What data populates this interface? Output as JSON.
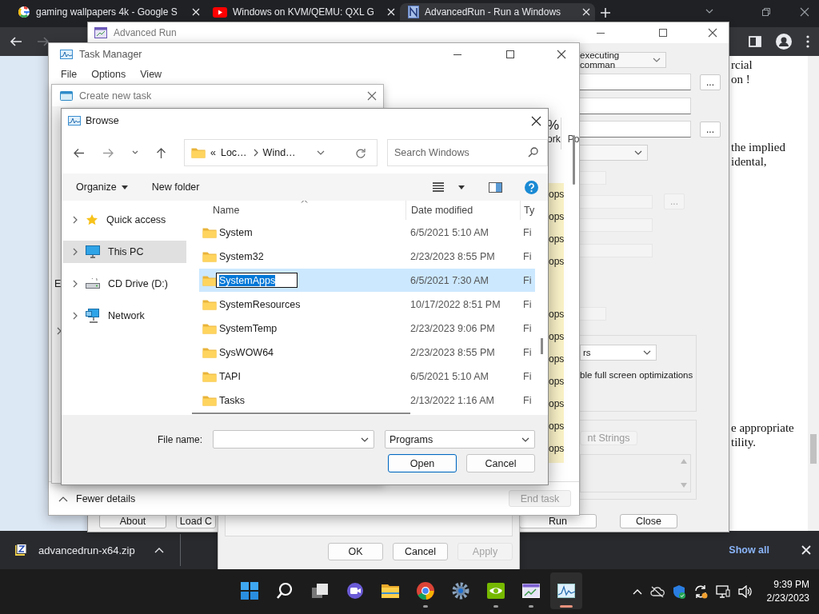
{
  "browser": {
    "tabs": [
      {
        "title": "gaming wallpapers 4k - Google S",
        "kind": "google",
        "selected": false
      },
      {
        "title": "Windows on KVM/QEMU: QXL G",
        "kind": "youtube",
        "selected": false
      },
      {
        "title": "AdvancedRun - Run a Windows",
        "kind": "site",
        "selected": true
      }
    ],
    "page_paragraphs": [
      {
        "lines": [
          "rcial",
          "on !"
        ]
      },
      {
        "lines": [
          "the implied",
          "idental,"
        ]
      },
      {
        "lines": [
          "e appropriate",
          "tility."
        ]
      }
    ]
  },
  "downloads": {
    "file": "advancedrun-x64.zip",
    "show_all": "Show all"
  },
  "advanced_run": {
    "title": "Advanced Run",
    "run_mode": "executing comman",
    "ellipsis_buttons": [
      {
        "label": "...",
        "disabled": false
      },
      {
        "label": "...",
        "disabled": false
      },
      {
        "label": "...",
        "disabled": true
      }
    ],
    "window_state": "rs",
    "fullscreen_option": "ble full screen optimizations",
    "strings_button": "nt Strings",
    "buttons": [
      "About",
      "Load C",
      "Run",
      "Close"
    ]
  },
  "properties_dialog": {
    "buttons": [
      {
        "label": "OK",
        "disabled": false
      },
      {
        "label": "Cancel",
        "disabled": false
      },
      {
        "label": "Apply",
        "disabled": true
      }
    ]
  },
  "task_manager": {
    "title": "Task Manager",
    "menu": [
      "File",
      "Options",
      "View"
    ],
    "column_percent": "%",
    "column_labels": [
      "ork",
      "Po"
    ],
    "cells_upper": [
      "ops",
      "ops",
      "ops",
      "ops"
    ],
    "cells_lower": [
      "ops",
      "ops",
      "ops",
      "ops",
      "ops",
      "ops",
      "ops"
    ],
    "fewer_details": "Fewer details",
    "end_task": {
      "label": "End task",
      "disabled": true
    }
  },
  "create_new_task": {
    "title": "Create new task",
    "fragment": "E"
  },
  "browse": {
    "title": "Browse",
    "path_overflow": "«",
    "path": [
      "Loc…",
      "Wind…"
    ],
    "search_placeholder": "Search Windows",
    "toolbar": {
      "organize": "Organize",
      "new_folder": "New folder"
    },
    "tree": [
      {
        "label": "Quick access",
        "kind": "star",
        "selected": false
      },
      {
        "label": "This PC",
        "kind": "pc",
        "selected": true
      },
      {
        "label": "CD Drive (D:)",
        "kind": "drive",
        "selected": false
      },
      {
        "label": "Network",
        "kind": "network",
        "selected": false
      }
    ],
    "columns": [
      "Name",
      "Date modified",
      "Ty"
    ],
    "rows": [
      {
        "name": "System",
        "date": "6/5/2021 5:10 AM",
        "type": "Fi",
        "selected": false,
        "renaming": false
      },
      {
        "name": "System32",
        "date": "2/23/2023 8:55 PM",
        "type": "Fi",
        "selected": false,
        "renaming": false
      },
      {
        "name": "SystemApps",
        "date": "6/5/2021 7:30 AM",
        "type": "Fi",
        "selected": true,
        "renaming": true
      },
      {
        "name": "SystemResources",
        "date": "10/17/2022 8:51 PM",
        "type": "Fi",
        "selected": false,
        "renaming": false
      },
      {
        "name": "SystemTemp",
        "date": "2/23/2023 9:06 PM",
        "type": "Fi",
        "selected": false,
        "renaming": false
      },
      {
        "name": "SysWOW64",
        "date": "2/23/2023 8:55 PM",
        "type": "Fi",
        "selected": false,
        "renaming": false
      },
      {
        "name": "TAPI",
        "date": "6/5/2021 5:10 AM",
        "type": "Fi",
        "selected": false,
        "renaming": false
      },
      {
        "name": "Tasks",
        "date": "2/13/2022 1:16 AM",
        "type": "Fi",
        "selected": false,
        "renaming": false
      }
    ],
    "file_name_label": "File name:",
    "file_type": "Programs",
    "open": "Open",
    "cancel": "Cancel"
  },
  "taskbar": {
    "apps": [
      {
        "kind": "start",
        "running": false,
        "active": false
      },
      {
        "kind": "search",
        "running": false,
        "active": false
      },
      {
        "kind": "taskview",
        "running": false,
        "active": false
      },
      {
        "kind": "chat",
        "running": false,
        "active": false
      },
      {
        "kind": "explorer",
        "running": false,
        "active": false
      },
      {
        "kind": "chrome",
        "running": true,
        "active": false
      },
      {
        "kind": "settings",
        "running": false,
        "active": false
      },
      {
        "kind": "nvidia",
        "running": true,
        "active": false
      },
      {
        "kind": "advancedrun",
        "running": true,
        "active": false
      },
      {
        "kind": "taskmanager",
        "running": true,
        "active": true
      }
    ],
    "time": "9:39 PM",
    "date": "2/23/2023"
  }
}
